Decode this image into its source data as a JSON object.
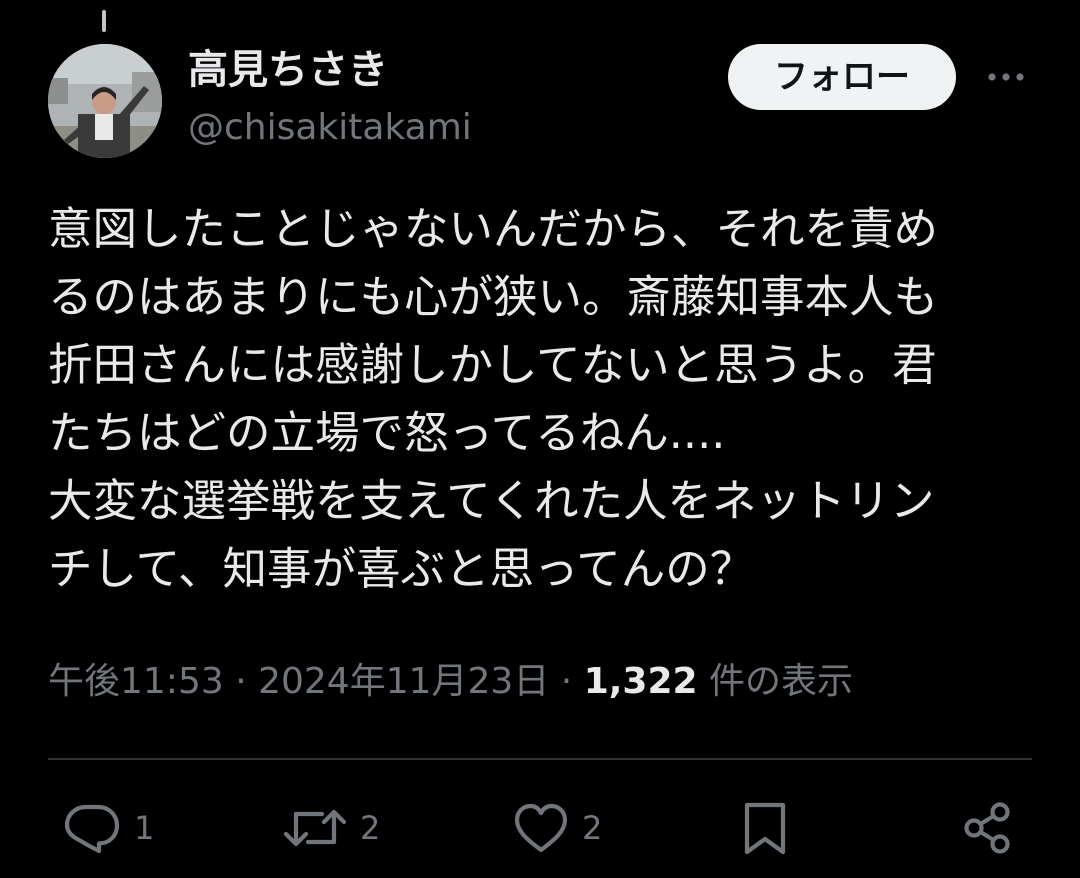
{
  "author": {
    "display_name": "高見ちさき",
    "handle": "@chisakitakami"
  },
  "follow_label": "フォロー",
  "tweet": {
    "lines": [
      "意図したことじゃないんだから、それを責め",
      "るのはあまりにも心が狭い。斎藤知事本人も",
      "折田さんには感謝しかしてないと思うよ。君",
      "たちはどの立場で怒ってるねん....",
      "大変な選挙戦を支えてくれた人をネットリン",
      "チして、知事が喜ぶと思ってんの？"
    ]
  },
  "meta": {
    "time": "午後11:53",
    "separator": " · ",
    "date": "2024年11月23日",
    "views_count": "1,322",
    "views_label": " 件の表示"
  },
  "actions": {
    "reply_count": "1",
    "repost_count": "2",
    "like_count": "2"
  },
  "colors": {
    "background": "#000000",
    "text_primary": "#e7e9ea",
    "text_secondary": "#71767b",
    "follow_button_bg": "#eff3f4",
    "divider": "#2f3336"
  },
  "icons": {
    "more": "more-horizontal-icon",
    "reply": "reply-bubble-icon",
    "repost": "repost-arrows-icon",
    "like": "heart-icon",
    "bookmark": "bookmark-icon",
    "share": "share-nodes-icon"
  }
}
